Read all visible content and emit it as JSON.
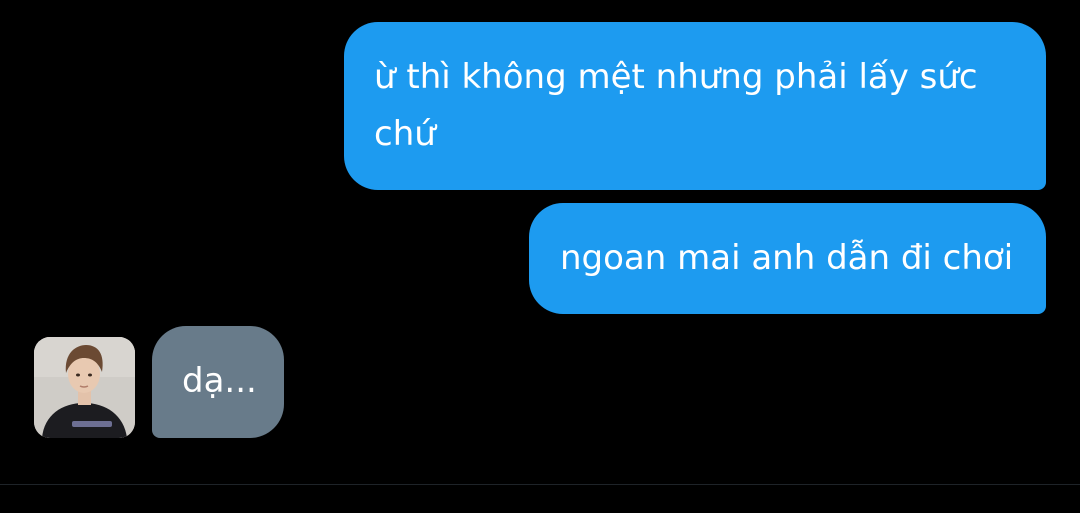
{
  "conversation": {
    "messages": [
      {
        "sender": "me",
        "text": "ừ thì không mệt nhưng phải lấy sức chứ"
      },
      {
        "sender": "me",
        "text": "ngoan mai anh dẫn đi chơi"
      },
      {
        "sender": "other",
        "text": "dạ..."
      }
    ],
    "colors": {
      "background": "#000000",
      "sent_bubble": "#1d9bf0",
      "received_bubble": "#687b8a",
      "text": "#ffffff"
    },
    "avatar_icon": "user-photo-avatar"
  }
}
